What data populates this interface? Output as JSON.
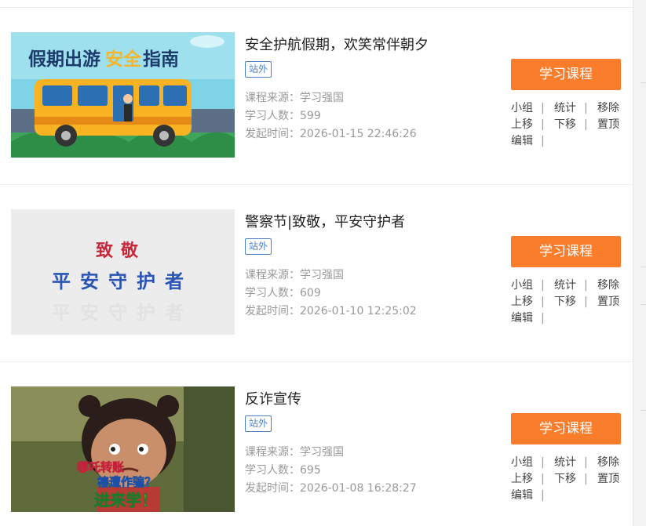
{
  "courses": [
    {
      "title": "安全护航假期，欢笑常伴朝夕",
      "tag": "站外",
      "source": "课程来源：学习强国",
      "learners": "学习人数：599",
      "started": "发起时间：2026-01-15 22:46:26",
      "button": "学习课程",
      "thumb_text": "假期出游安全指南",
      "thumb_highlight": "安全"
    },
    {
      "title": "警察节|致敬，平安守护者",
      "tag": "站外",
      "source": "课程来源：学习强国",
      "learners": "学习人数：609",
      "started": "发起时间：2026-01-10 12:25:02",
      "button": "学习课程",
      "thumb_text_1": "致敬",
      "thumb_text_2": "平安守护者"
    },
    {
      "title": "反诈宣传",
      "tag": "站外",
      "source": "课程来源：学习强国",
      "learners": "学习人数：695",
      "started": "发起时间：2026-01-08 16:28:27",
      "button": "学习课程",
      "thumb_text_1": "哪吒转账",
      "thumb_text_2": "樁遭作骗？",
      "thumb_text_3": "进来学！"
    }
  ],
  "actions": {
    "group": "小组",
    "stats": "统计",
    "remove": "移除",
    "up": "上移",
    "down": "下移",
    "top": "置顶",
    "edit": "编辑",
    "separator": "|"
  },
  "colors": {
    "button": "#fa7d2b",
    "tag": "#4d7fc5",
    "meta": "#999999"
  }
}
